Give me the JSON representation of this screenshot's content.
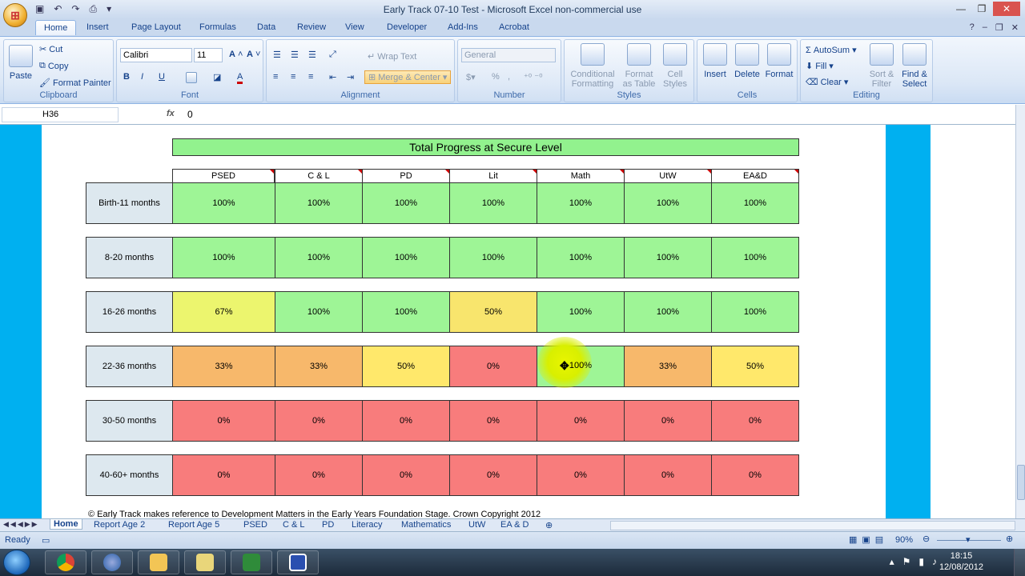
{
  "window": {
    "title": "Early Track 07-10 Test - Microsoft Excel non-commercial use"
  },
  "ribbon_tabs": [
    "Home",
    "Insert",
    "Page Layout",
    "Formulas",
    "Data",
    "Review",
    "View",
    "Developer",
    "Add-Ins",
    "Acrobat"
  ],
  "clipboard": {
    "paste": "Paste",
    "cut": "Cut",
    "copy": "Copy",
    "format_painter": "Format Painter",
    "label": "Clipboard"
  },
  "font": {
    "name": "Calibri",
    "size": "11",
    "label": "Font"
  },
  "alignment": {
    "wrap": "Wrap Text",
    "merge": "Merge & Center",
    "label": "Alignment"
  },
  "number": {
    "format": "General",
    "label": "Number"
  },
  "styles": {
    "conditional": "Conditional Formatting",
    "format_table": "Format as Table",
    "cell_styles": "Cell Styles",
    "label": "Styles"
  },
  "cells": {
    "insert": "Insert",
    "delete": "Delete",
    "format": "Format",
    "label": "Cells"
  },
  "editing": {
    "autosum": "AutoSum",
    "fill": "Fill",
    "clear": "Clear",
    "sort": "Sort & Filter",
    "find": "Find & Select",
    "label": "Editing"
  },
  "formula_bar": {
    "cell_ref": "H36",
    "fx": "fx",
    "value": "0"
  },
  "sheet": {
    "title": "Total Progress at Secure Level",
    "columns": [
      "PSED",
      "C & L",
      "PD",
      "Lit",
      "Math",
      "UtW",
      "EA&D"
    ],
    "rows": [
      {
        "label": "Birth-11 months",
        "values": [
          "100%",
          "100%",
          "100%",
          "100%",
          "100%",
          "100%",
          "100%"
        ]
      },
      {
        "label": "8-20 months",
        "values": [
          "100%",
          "100%",
          "100%",
          "100%",
          "100%",
          "100%",
          "100%"
        ]
      },
      {
        "label": "16-26 months",
        "values": [
          "67%",
          "100%",
          "100%",
          "50%",
          "100%",
          "100%",
          "100%"
        ]
      },
      {
        "label": "22-36 months",
        "values": [
          "33%",
          "33%",
          "50%",
          "0%",
          "100%",
          "33%",
          "50%"
        ]
      },
      {
        "label": "30-50 months",
        "values": [
          "0%",
          "0%",
          "0%",
          "0%",
          "0%",
          "0%",
          "0%"
        ]
      },
      {
        "label": "40-60+ months",
        "values": [
          "0%",
          "0%",
          "0%",
          "0%",
          "0%",
          "0%",
          "0%"
        ]
      }
    ],
    "copyright": "© Early Track makes reference to Development Matters in the Early Years Foundation Stage. Crown Copyright 2012"
  },
  "sheet_tabs": [
    "Home",
    "Report Age 2",
    "Report Age 5",
    "PSED",
    "C & L",
    "PD",
    "Literacy",
    "Mathematics",
    "UtW",
    "EA & D"
  ],
  "status": {
    "ready": "Ready",
    "zoom": "90%"
  },
  "taskbar": {
    "time": "18:15",
    "date": "12/08/2012"
  }
}
